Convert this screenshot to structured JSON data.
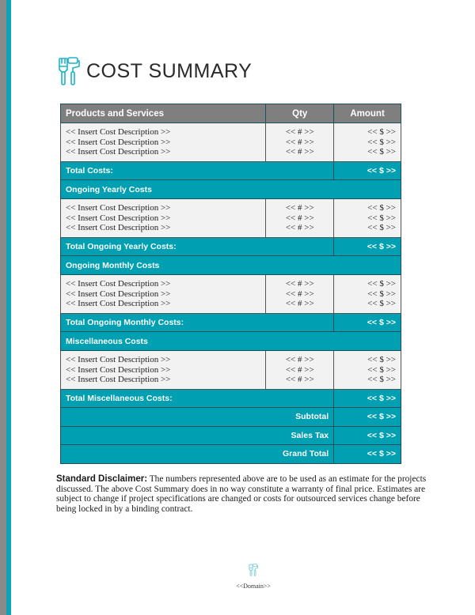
{
  "page": {
    "title": "COST SUMMARY",
    "title_icon": "paint-roller-brush-icon",
    "accent_color": "#009fb2",
    "header_color": "#7f7f7f"
  },
  "table": {
    "headers": {
      "description": "Products and Services",
      "qty": "Qty",
      "amount": "Amount"
    },
    "initial_items": [
      {
        "description": "<< Insert Cost Description >>",
        "qty": "<< # >>",
        "amount": "<< $ >>"
      },
      {
        "description": "<< Insert Cost Description >>",
        "qty": "<< # >>",
        "amount": "<< $ >>"
      },
      {
        "description": "<< Insert Cost Description >>",
        "qty": "<< # >>",
        "amount": "<< $ >>"
      }
    ],
    "total_costs": {
      "label": "Total Costs:",
      "value": "<< $ >>"
    },
    "sections": [
      {
        "title": "Ongoing Yearly Costs",
        "items": [
          {
            "description": "<< Insert Cost Description >>",
            "qty": "<< # >>",
            "amount": "<< $ >>"
          },
          {
            "description": "<< Insert Cost Description >>",
            "qty": "<< # >>",
            "amount": "<< $ >>"
          },
          {
            "description": "<< Insert Cost Description >>",
            "qty": "<< # >>",
            "amount": "<< $ >>"
          }
        ],
        "total_label": "Total Ongoing Yearly Costs:",
        "total_value": "<< $ >>"
      },
      {
        "title": "Ongoing Monthly Costs",
        "items": [
          {
            "description": "<< Insert Cost Description >>",
            "qty": "<< # >>",
            "amount": "<< $ >>"
          },
          {
            "description": "<< Insert Cost Description >>",
            "qty": "<< # >>",
            "amount": "<< $ >>"
          },
          {
            "description": "<< Insert Cost Description >>",
            "qty": "<< # >>",
            "amount": "<< $ >>"
          }
        ],
        "total_label": "Total Ongoing Monthly Costs:",
        "total_value": "<< $ >>"
      },
      {
        "title": "Miscellaneous Costs",
        "items": [
          {
            "description": "<< Insert Cost Description >>",
            "qty": "<< # >>",
            "amount": "<< $ >>"
          },
          {
            "description": "<< Insert Cost Description >>",
            "qty": "<< # >>",
            "amount": "<< $ >>"
          },
          {
            "description": "<< Insert Cost Description >>",
            "qty": "<< # >>",
            "amount": "<< $ >>"
          }
        ],
        "total_label": "Total Miscellaneous Costs:",
        "total_value": "<< $ >>"
      }
    ],
    "summary": [
      {
        "label": "Subtotal",
        "value": "<< $ >>"
      },
      {
        "label": "Sales Tax",
        "value": "<< $ >>"
      },
      {
        "label": "Grand Total",
        "value": "<< $ >>"
      }
    ]
  },
  "disclaimer": {
    "label": "Standard Disclaimer:",
    "text": " The numbers represented above are to be used as an estimate for the projects discussed. The above Cost Summary does in no way constitute a warranty of final price.  Estimates are subject to change if project specifications are changed or costs for outsourced services change before being locked in by a binding contract."
  },
  "footer": {
    "icon": "paint-roller-brush-icon",
    "text": "<<Domain>>"
  }
}
